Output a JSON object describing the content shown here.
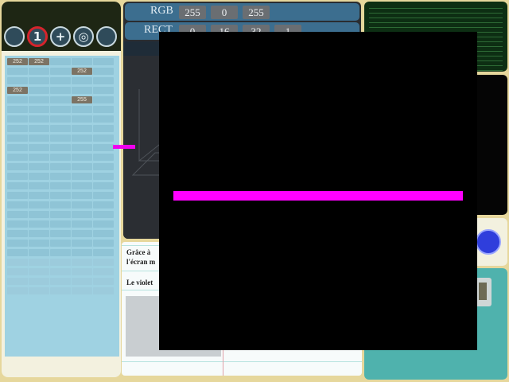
{
  "toolbar": {
    "buttons": [
      {
        "name": "circle-tool-button",
        "glyph": "",
        "active": false
      },
      {
        "name": "step-one-button",
        "glyph": "1",
        "active": true
      },
      {
        "name": "add-button",
        "glyph": "+",
        "active": false
      },
      {
        "name": "target-button",
        "glyph": "◎",
        "active": false
      },
      {
        "name": "circle-tool-button-2",
        "glyph": "",
        "active": false
      }
    ]
  },
  "grid": {
    "columns": 5,
    "rows": 25,
    "tags": [
      "252",
      "252",
      "252",
      "252",
      "255"
    ]
  },
  "rgb": {
    "label": "RGB",
    "values": [
      "255",
      "0",
      "255"
    ]
  },
  "rect": {
    "label": "RECT",
    "values": [
      "0",
      "16",
      "32",
      "1"
    ]
  },
  "notes": {
    "line1": "Grâce à",
    "line2": "l'écran m",
    "line3": "Le violet"
  },
  "colors": {
    "background": "#e6d79c",
    "overlay": "#000000",
    "trace": "#ff00ff",
    "panel_blue": "#3c6e8f",
    "grid_blue": "#9fd2e2",
    "teal": "#4fb2ad",
    "dot_blue": "#2f3edc"
  }
}
